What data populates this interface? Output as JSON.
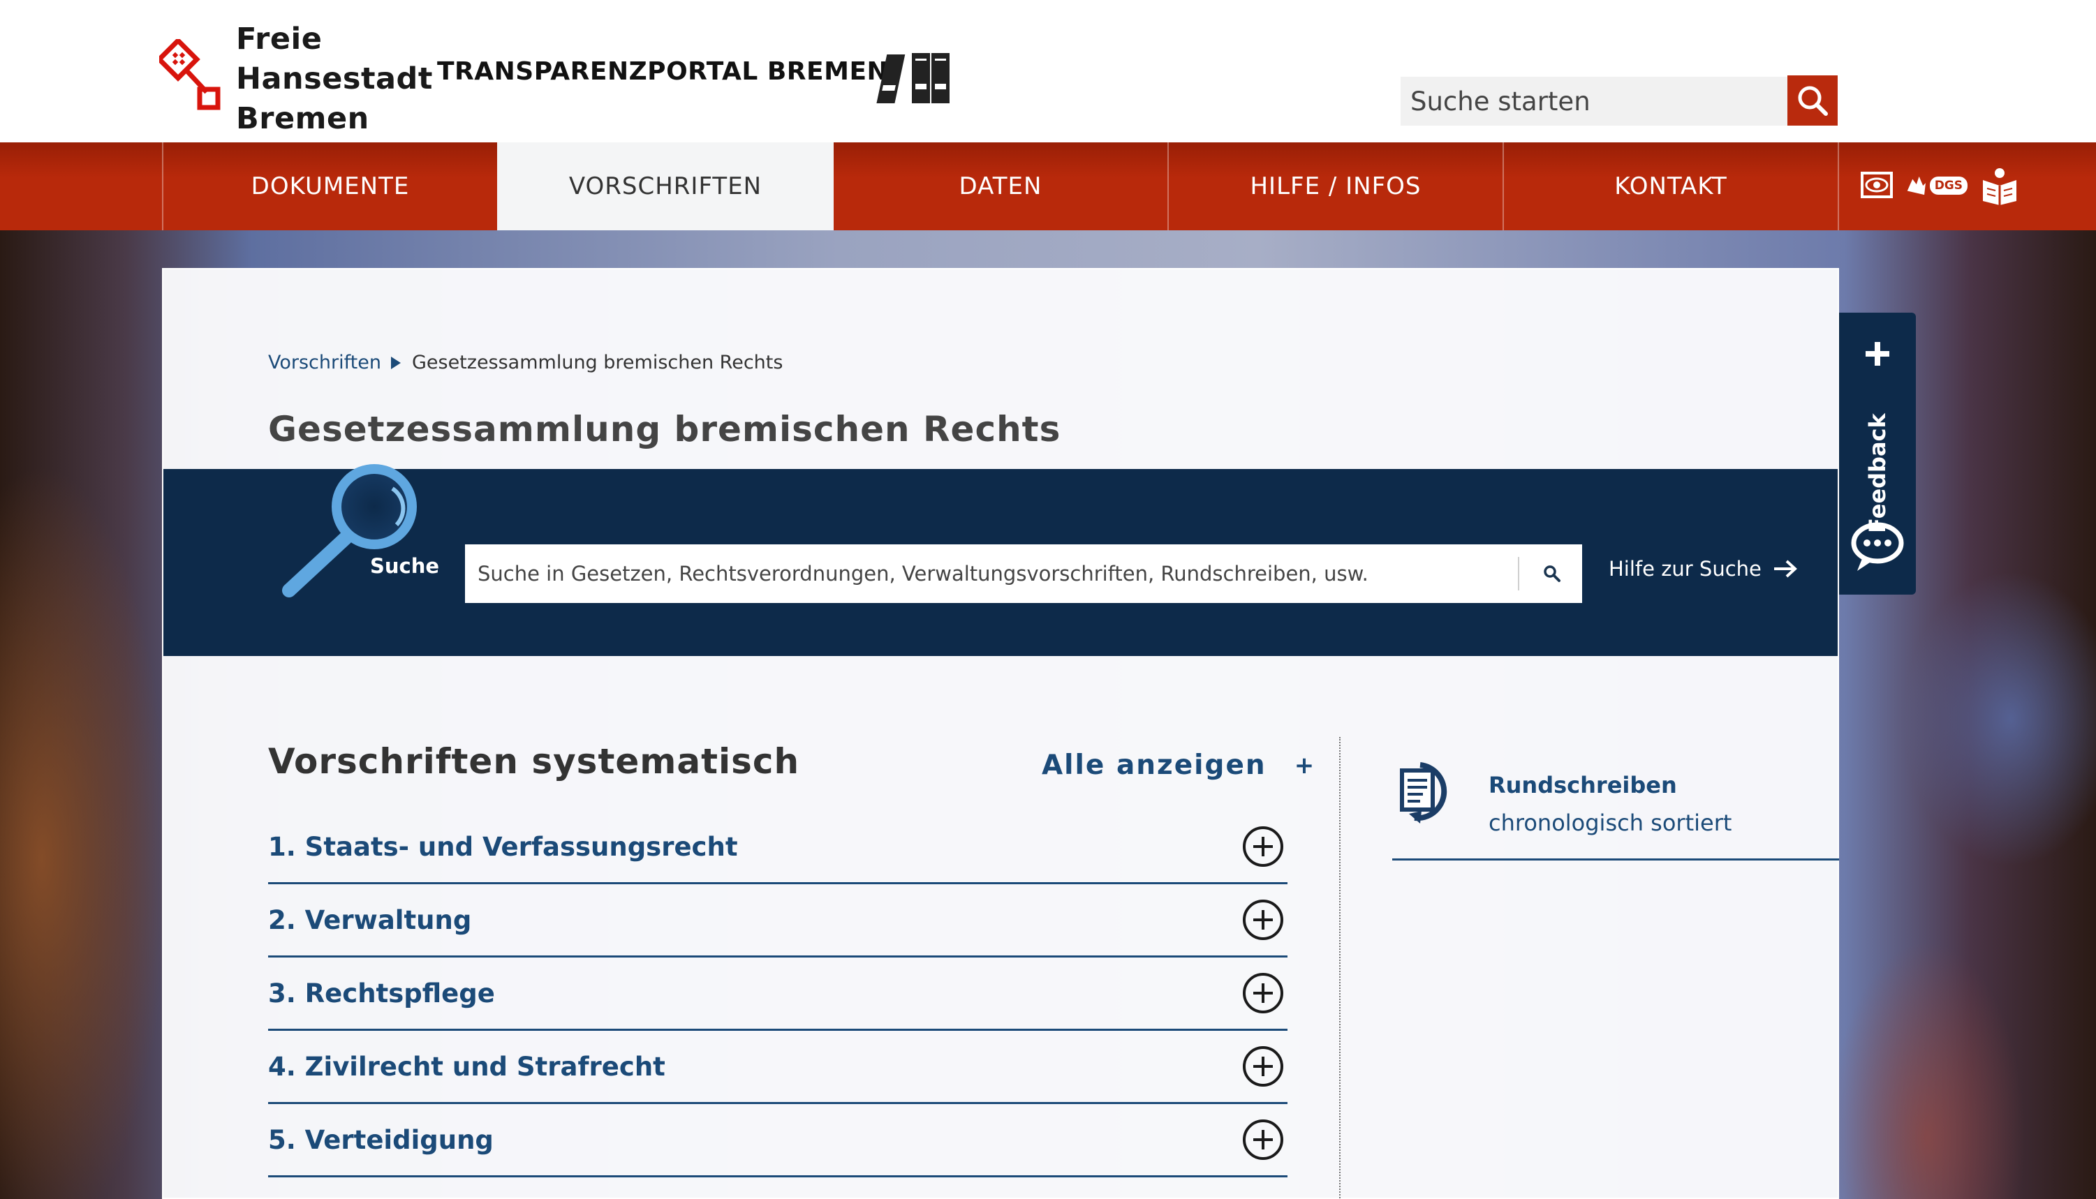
{
  "header": {
    "logo_lines": [
      "Freie",
      "Hansestadt",
      "Bremen"
    ],
    "portal_title": "TRANSPARENZPORTAL BREMEN",
    "search_placeholder": "Suche starten"
  },
  "nav": {
    "items": [
      {
        "label": "DOKUMENTE",
        "active": false
      },
      {
        "label": "VORSCHRIFTEN",
        "active": true
      },
      {
        "label": "DATEN",
        "active": false
      },
      {
        "label": "HILFE / INFOS",
        "active": false
      },
      {
        "label": "KONTAKT",
        "active": false
      }
    ],
    "utility_icons": [
      "eye-icon",
      "sign-language-icon",
      "easy-language-icon"
    ],
    "sign_language_badge": "DGS"
  },
  "breadcrumb": {
    "parent": "Vorschriften",
    "current": "Gesetzessammlung bremischen Rechts"
  },
  "page_title": "Gesetzessammlung bremischen Rechts",
  "search": {
    "label": "Suche",
    "placeholder": "Suche in Gesetzen, Rechtsverordnungen, Verwaltungsvorschriften, Rundschreiben, usw.",
    "help_link": "Hilfe zur Suche"
  },
  "systematic": {
    "title": "Vorschriften systematisch",
    "show_all": "Alle anzeigen",
    "show_all_symbol": "+",
    "categories": [
      "1. Staats- und Verfassungsrecht",
      "2. Verwaltung",
      "3. Rechtspflege",
      "4. Zivilrecht und Strafrecht",
      "5. Verteidigung"
    ]
  },
  "rundschreiben": {
    "title": "Rundschreiben",
    "subtitle": "chronologisch sortiert"
  },
  "feedback": {
    "label": "Feedback"
  },
  "colors": {
    "brand_red": "#b8290b",
    "navy": "#0d2a4a",
    "link_blue": "#1b4a78"
  }
}
